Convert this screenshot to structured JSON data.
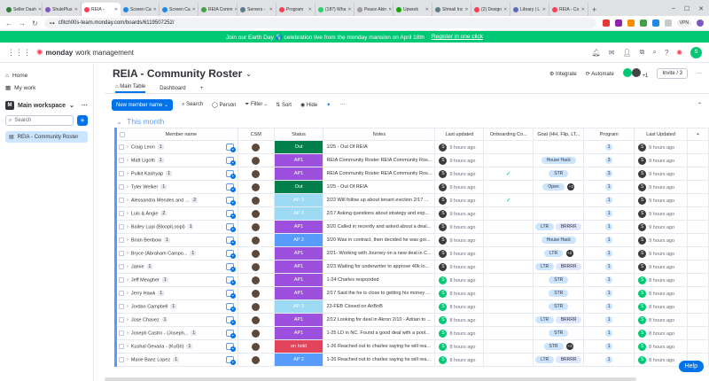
{
  "browser": {
    "tabs": [
      {
        "label": "Seller Dash",
        "color": "#2e7d32"
      },
      {
        "label": "ShulePlus",
        "color": "#7e57c2"
      },
      {
        "label": "REIA -",
        "color": "#ff3d57",
        "active": true
      },
      {
        "label": "Screen Ca",
        "color": "#1e88e5"
      },
      {
        "label": "Screen Ca",
        "color": "#1e88e5"
      },
      {
        "label": "REIA Comm",
        "color": "#43a047"
      },
      {
        "label": "Servers - ",
        "color": "#607d8b"
      },
      {
        "label": "Program",
        "color": "#ff3d57"
      },
      {
        "label": "(187) Wha",
        "color": "#25d366"
      },
      {
        "label": "Peace Akin",
        "color": "#9e9e9e"
      },
      {
        "label": "Upwork",
        "color": "#14a800"
      },
      {
        "label": "Shmail Inc",
        "color": "#607d8b"
      },
      {
        "label": "(2) Design",
        "color": "#ff3d57"
      },
      {
        "label": "Library | L",
        "color": "#5c6bc0"
      },
      {
        "label": "REIA - Co",
        "color": "#ff3d57"
      }
    ],
    "url": "cfitch00s-team.monday.com/boards/6119507252/",
    "vpn": "VPN"
  },
  "banner": {
    "text": "Join our Earth Day 🌎 celebration live from the monday mansion on April 18th",
    "link": "Register in one click"
  },
  "app": {
    "brand": "monday",
    "brand_rest": "work management"
  },
  "sidebar": {
    "home": "Home",
    "mywork": "My work",
    "workspace": "Main workspace",
    "ws_letter": "M",
    "search_placeholder": "Search",
    "board": "REIA - Community Roster"
  },
  "board": {
    "title": "REIA - Community Roster",
    "integrate": "Integrate",
    "automate": "Automate",
    "invite": "Invite / 3",
    "plus_people": "+1",
    "view_tabs": [
      "Main Table",
      "Dashboard"
    ],
    "toolbar": {
      "new_item": "New member name",
      "search": "Search",
      "person": "Person",
      "filter": "Filter",
      "sort": "Sort",
      "hide": "Hide"
    },
    "group_title": "This month",
    "columns": [
      "Member name",
      "CSM",
      "Status",
      "Notes",
      "Last updated",
      "Onboarding Co...",
      "Goal (HH, Flip, LT...",
      "Program",
      "Last Updated"
    ]
  },
  "colors": {
    "Out": "#037f4c",
    "AP1": "#9d50dd",
    "AP 2": "#579bfc",
    "AP 3": "#9cd9f3",
    "on hold": "#e2445c"
  },
  "rows": [
    {
      "name": "Craig Leon",
      "count": "1",
      "status": "Out",
      "notes": "1/25 - Out Of REIA",
      "lu": "9 hours ago",
      "onb": "",
      "goal": [],
      "program": "1",
      "lu2": "9 hours ago"
    },
    {
      "name": "Matt Ligotti",
      "count": "1",
      "status": "AP1",
      "notes": "REIA Community Roster REIA Community Ros...",
      "lu": "9 hours ago",
      "onb": "",
      "goal": [
        "House Hack"
      ],
      "program": "3",
      "lu2": "9 hours ago"
    },
    {
      "name": "Pulkit Kashyap",
      "count": "1",
      "status": "AP1",
      "notes": "REIA Community Roster REIA Community Ros...",
      "lu": "9 hours ago",
      "onb": "✓",
      "goal": [
        "STR"
      ],
      "program": "3",
      "lu2": "9 hours ago"
    },
    {
      "name": "Tyler Welker",
      "count": "1",
      "status": "Out",
      "notes": "1/25 - Out Of REIA",
      "lu": "9 hours ago",
      "onb": "",
      "goal": [
        "Open"
      ],
      "goal_more": "+3",
      "program": "1",
      "lu2": "9 hours ago"
    },
    {
      "name": "Alessandra Mendes and ...",
      "count": "2",
      "status": "AP 3",
      "notes": "2/22 Will follow up about tenant eviction 2/17 ...",
      "lu": "9 hours ago",
      "onb": "✓",
      "goal": [],
      "program": "1",
      "lu2": "9 hours ago"
    },
    {
      "name": "Luis & Angie",
      "count": "2",
      "status": "AP 3",
      "notes": "2/17 Asking questions about strategy and exp...",
      "lu": "9 hours ago",
      "onb": "",
      "goal": [],
      "program": "1",
      "lu2": "9 hours ago"
    },
    {
      "name": "Bailey Lupi (BloopiLoopi)",
      "count": "1",
      "status": "AP1",
      "notes": "3/20 Called in recently and asked about a deal...",
      "lu": "9 hours ago",
      "onb": "",
      "goal": [
        "LTR",
        "BRRRR"
      ],
      "program": "1",
      "lu2": "9 hours ago"
    },
    {
      "name": "Brian Benbow",
      "count": "1",
      "status": "AP 2",
      "notes": "3/20 Was in contract, then decided he was goi...",
      "lu": "9 hours ago",
      "onb": "",
      "goal": [
        "House Hack"
      ],
      "program": "1",
      "lu2": "9 hours ago"
    },
    {
      "name": "Bryce (Abraham Campo...",
      "count": "1",
      "status": "AP1",
      "notes": "2/21- Working with Journey on a new deal in C...",
      "lu": "9 hours ago",
      "onb": "",
      "goal": [
        "LTR"
      ],
      "goal_more": "+2",
      "program": "1",
      "lu2": "9 hours ago"
    },
    {
      "name": "Jamie",
      "count": "1",
      "status": "AP1",
      "notes": "2/23 Waiting for underwriter to approve 40k lo...",
      "lu": "9 hours ago",
      "onb": "",
      "goal": [
        "LTR",
        "BRRRR"
      ],
      "program": "1",
      "lu2": "9 hours ago"
    },
    {
      "name": "Jeff Meagher",
      "count": "1",
      "status": "AP1",
      "notes": "1-24 Charles responded",
      "lu": "8 hours ago",
      "onb": "",
      "goal": [
        "STR"
      ],
      "program": "1",
      "lu2": "8 hours ago"
    },
    {
      "name": "Jerry Hawk",
      "count": "1",
      "status": "AP1",
      "notes": "2/17 Said the he is close to getting his money ...",
      "lu": "8 hours ago",
      "onb": "",
      "goal": [
        "STR"
      ],
      "program": "1",
      "lu2": "8 hours ago"
    },
    {
      "name": "Jordan Campbell",
      "count": "1",
      "status": "AP 3",
      "notes": "23-FEB Closed on AirBnB",
      "lu": "8 hours ago",
      "onb": "",
      "goal": [
        "STR"
      ],
      "program": "1",
      "lu2": "8 hours ago"
    },
    {
      "name": "Jose Chavez",
      "count": "1",
      "status": "AP1",
      "notes": "2/12 Looking for deal in Akron 2/10 - Adrian to ...",
      "lu": "8 hours ago",
      "onb": "",
      "goal": [
        "LTR",
        "BRRRR"
      ],
      "program": "1",
      "lu2": "8 hours ago"
    },
    {
      "name": "Joseph Castro - (Joseph...",
      "count": "1",
      "status": "AP1",
      "notes": "1-25 LD in NC. Found a good deal with a pool...",
      "lu": "8 hours ago",
      "onb": "",
      "goal": [
        "STR"
      ],
      "program": "1",
      "lu2": "8 hours ago"
    },
    {
      "name": "Kushal Gevaria - (KuSh)",
      "count": "1",
      "status": "on hold",
      "notes": "1-26 Reached out to charles saying he will rea...",
      "lu": "8 hours ago",
      "onb": "",
      "goal": [
        "STR"
      ],
      "goal_more": "+2",
      "program": "1",
      "lu2": "8 hours ago"
    },
    {
      "name": "Marie Baez Lopez",
      "count": "1",
      "status": "AP 2",
      "notes": "1-26 Reached out to charles saying he will rea...",
      "lu": "8 hours ago",
      "onb": "",
      "goal": [
        "LTR",
        "BRRRR"
      ],
      "program": "1",
      "lu2": "8 hours ago"
    }
  ],
  "help": "Help"
}
